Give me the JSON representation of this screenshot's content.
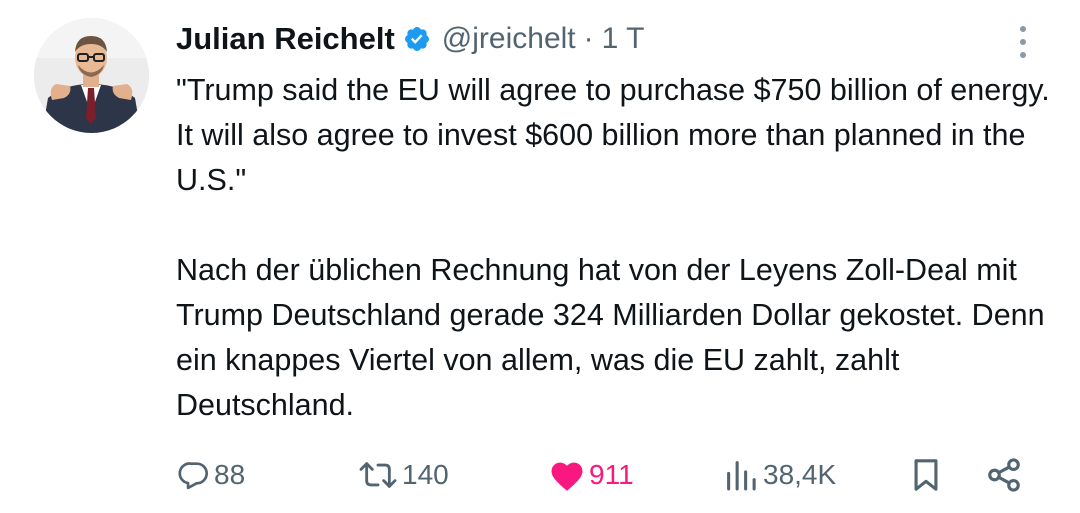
{
  "tweet": {
    "author_name": "Julian Reichelt",
    "handle": "@jreichelt",
    "separator": "·",
    "timestamp": "1 T",
    "paragraphs": [
      "\"Trump said the EU will agree to purchase $750 billion of energy. It will also agree to invest $600 billion more than planned in the U.S.\"",
      "Nach der üblichen Rechnung hat von der Leyens Zoll-Deal mit Trump Deutschland gerade 324 Milliarden Dollar gekostet. Denn ein knappes Viertel von allem, was die EU zahlt, zahlt Deutschland."
    ]
  },
  "actions": {
    "replies": "88",
    "retweets": "140",
    "likes": "911",
    "views": "38,4K"
  },
  "colors": {
    "text": "#0f1419",
    "secondary": "#536471",
    "verified": "#1d9bf0",
    "like": "#f91880"
  },
  "icons": [
    "verified-badge-icon",
    "more-options-icon",
    "reply-icon",
    "retweet-icon",
    "like-icon",
    "views-icon",
    "bookmark-icon",
    "share-icon"
  ]
}
